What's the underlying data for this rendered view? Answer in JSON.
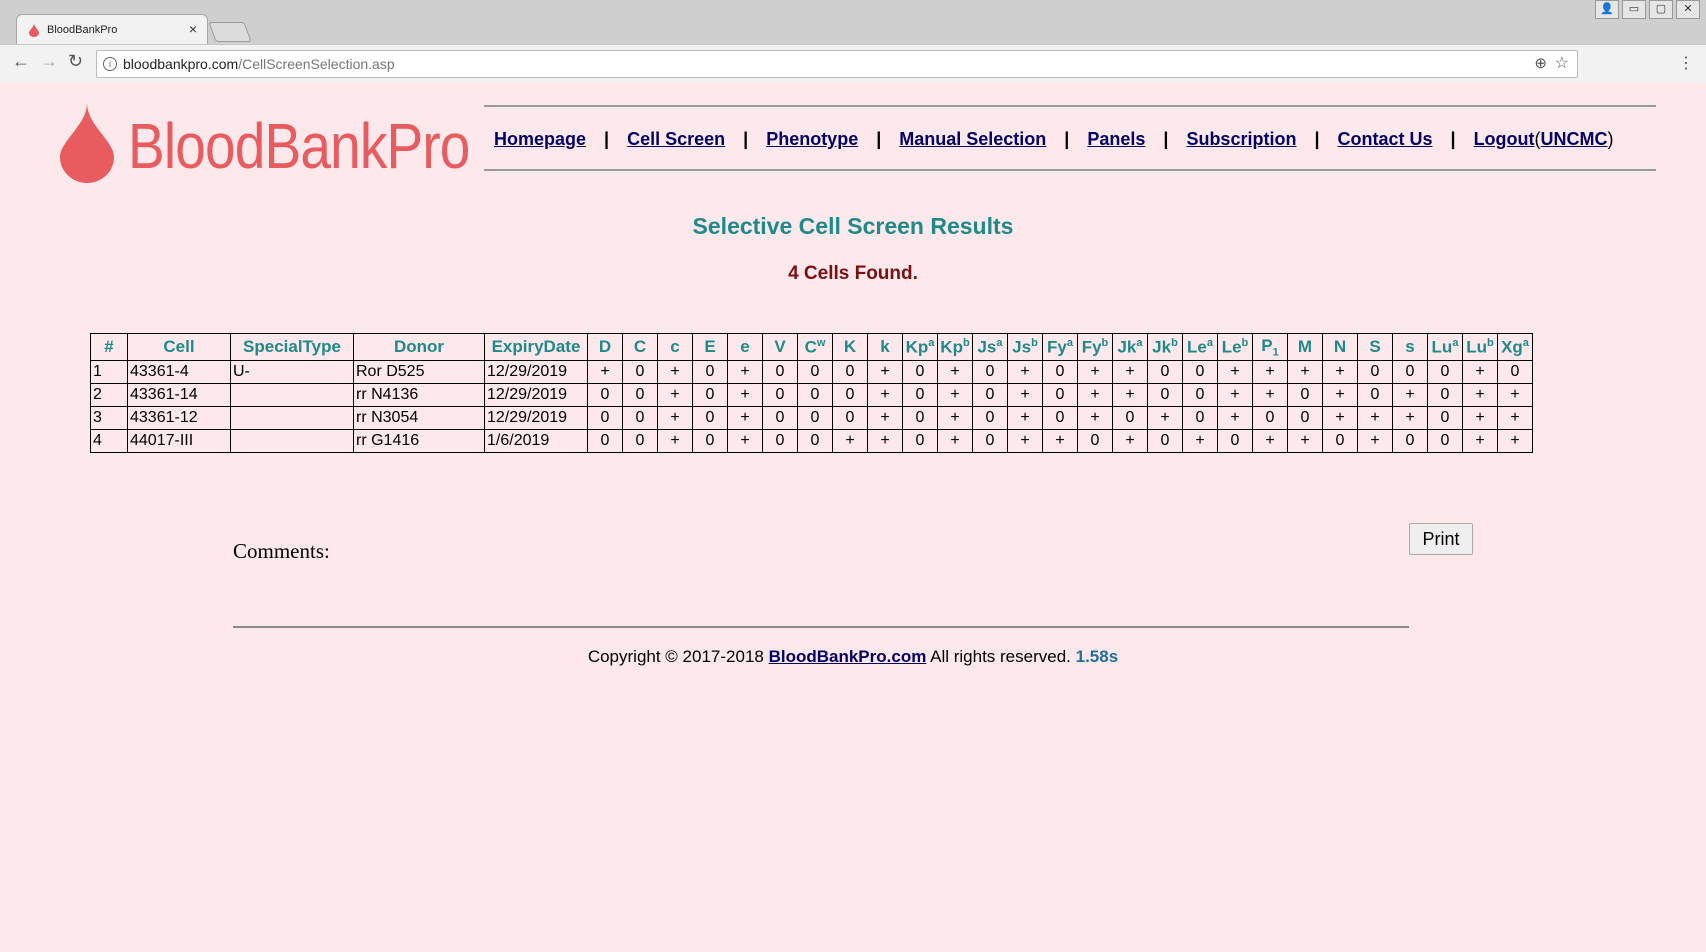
{
  "browser": {
    "tab_title": "BloodBankPro",
    "tab_close": "×",
    "url_host": "bloodbankpro.com",
    "url_path": "/CellScreenSelection.asp",
    "back": "←",
    "forward": "→",
    "reload": "↻",
    "zoom_icon": "⊕",
    "star_icon": "☆",
    "menu_icon": "⋮",
    "info_icon": "i",
    "win_user": "👤",
    "win_min": "▭",
    "win_max": "▢",
    "win_close": "✕"
  },
  "logo": {
    "text": "BloodBankPro",
    "color": "#e85b5e"
  },
  "nav": {
    "items": [
      "Homepage",
      "Cell Screen",
      "Phenotype",
      "Manual Selection",
      "Panels",
      "Subscription",
      "Contact Us",
      "Logout"
    ],
    "separator": "|",
    "user_open": "(",
    "user": "UNCMC",
    "user_close": ")"
  },
  "page_title": "Selective Cell Screen Results",
  "count_text": "4 Cells Found.",
  "table": {
    "headers": [
      {
        "base": "#"
      },
      {
        "base": "Cell"
      },
      {
        "base": "SpecialType"
      },
      {
        "base": "Donor"
      },
      {
        "base": "ExpiryDate"
      },
      {
        "base": "D"
      },
      {
        "base": "C"
      },
      {
        "base": "c"
      },
      {
        "base": "E"
      },
      {
        "base": "e"
      },
      {
        "base": "V"
      },
      {
        "base": "C",
        "sup": "w"
      },
      {
        "base": "K"
      },
      {
        "base": "k"
      },
      {
        "base": "Kp",
        "sup": "a"
      },
      {
        "base": "Kp",
        "sup": "b"
      },
      {
        "base": "Js",
        "sup": "a"
      },
      {
        "base": "Js",
        "sup": "b"
      },
      {
        "base": "Fy",
        "sup": "a"
      },
      {
        "base": "Fy",
        "sup": "b"
      },
      {
        "base": "Jk",
        "sup": "a"
      },
      {
        "base": "Jk",
        "sup": "b"
      },
      {
        "base": "Le",
        "sup": "a"
      },
      {
        "base": "Le",
        "sup": "b"
      },
      {
        "base": "P",
        "sub": "1"
      },
      {
        "base": "M"
      },
      {
        "base": "N"
      },
      {
        "base": "S"
      },
      {
        "base": "s"
      },
      {
        "base": "Lu",
        "sup": "a"
      },
      {
        "base": "Lu",
        "sup": "b"
      },
      {
        "base": "Xg",
        "sup": "a"
      }
    ],
    "rows": [
      [
        "1",
        "43361-4",
        "U-",
        "Ror D525",
        "12/29/2019",
        "+",
        "0",
        "+",
        "0",
        "+",
        "0",
        "0",
        "0",
        "+",
        "0",
        "+",
        "0",
        "+",
        "0",
        "+",
        "+",
        "0",
        "0",
        "+",
        "+",
        "+",
        "+",
        "0",
        "0",
        "0",
        "+",
        "0"
      ],
      [
        "2",
        "43361-14",
        "",
        "rr N4136",
        "12/29/2019",
        "0",
        "0",
        "+",
        "0",
        "+",
        "0",
        "0",
        "0",
        "+",
        "0",
        "+",
        "0",
        "+",
        "0",
        "+",
        "+",
        "0",
        "0",
        "+",
        "+",
        "0",
        "+",
        "0",
        "+",
        "0",
        "+",
        "+"
      ],
      [
        "3",
        "43361-12",
        "",
        "rr N3054",
        "12/29/2019",
        "0",
        "0",
        "+",
        "0",
        "+",
        "0",
        "0",
        "0",
        "+",
        "0",
        "+",
        "0",
        "+",
        "0",
        "+",
        "0",
        "+",
        "0",
        "+",
        "0",
        "0",
        "+",
        "+",
        "+",
        "0",
        "+",
        "+"
      ],
      [
        "4",
        "44017-III",
        "",
        "rr G1416",
        "1/6/2019",
        "0",
        "0",
        "+",
        "0",
        "+",
        "0",
        "0",
        "+",
        "+",
        "0",
        "+",
        "0",
        "+",
        "+",
        "0",
        "+",
        "0",
        "+",
        "0",
        "+",
        "+",
        "0",
        "+",
        "0",
        "0",
        "+",
        "+"
      ]
    ]
  },
  "print_label": "Print",
  "comments_label": "Comments:",
  "footer": {
    "prefix": "Copyright © 2017-2018 ",
    "link": "BloodBankPro.com",
    "suffix": " All rights reserved. ",
    "time": "1.58s"
  }
}
